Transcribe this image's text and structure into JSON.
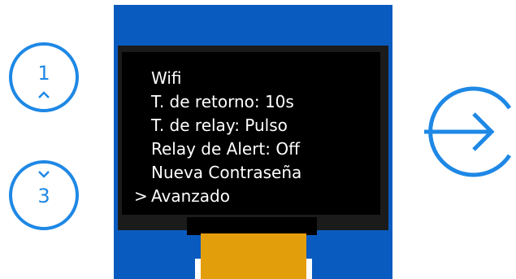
{
  "nav": {
    "up_button": {
      "number": "1",
      "icon": "chevron-up-icon"
    },
    "down_button": {
      "number": "3",
      "icon": "chevron-down-icon"
    },
    "enter_button": {
      "icon": "arrow-right-icon"
    }
  },
  "screen": {
    "cursor": ">",
    "selected_index": 5,
    "items": [
      {
        "label": "Wifi"
      },
      {
        "label": "T. de retorno: 10s"
      },
      {
        "label": "T. de relay: Pulso"
      },
      {
        "label": "Relay de Alert: Off"
      },
      {
        "label": "Nueva Contraseña"
      },
      {
        "label": "Avanzado"
      }
    ]
  },
  "colors": {
    "accent": "#1e88e5",
    "board": "#0a5bbf",
    "screen": "#000000",
    "ribbon": "#e39e0c"
  }
}
